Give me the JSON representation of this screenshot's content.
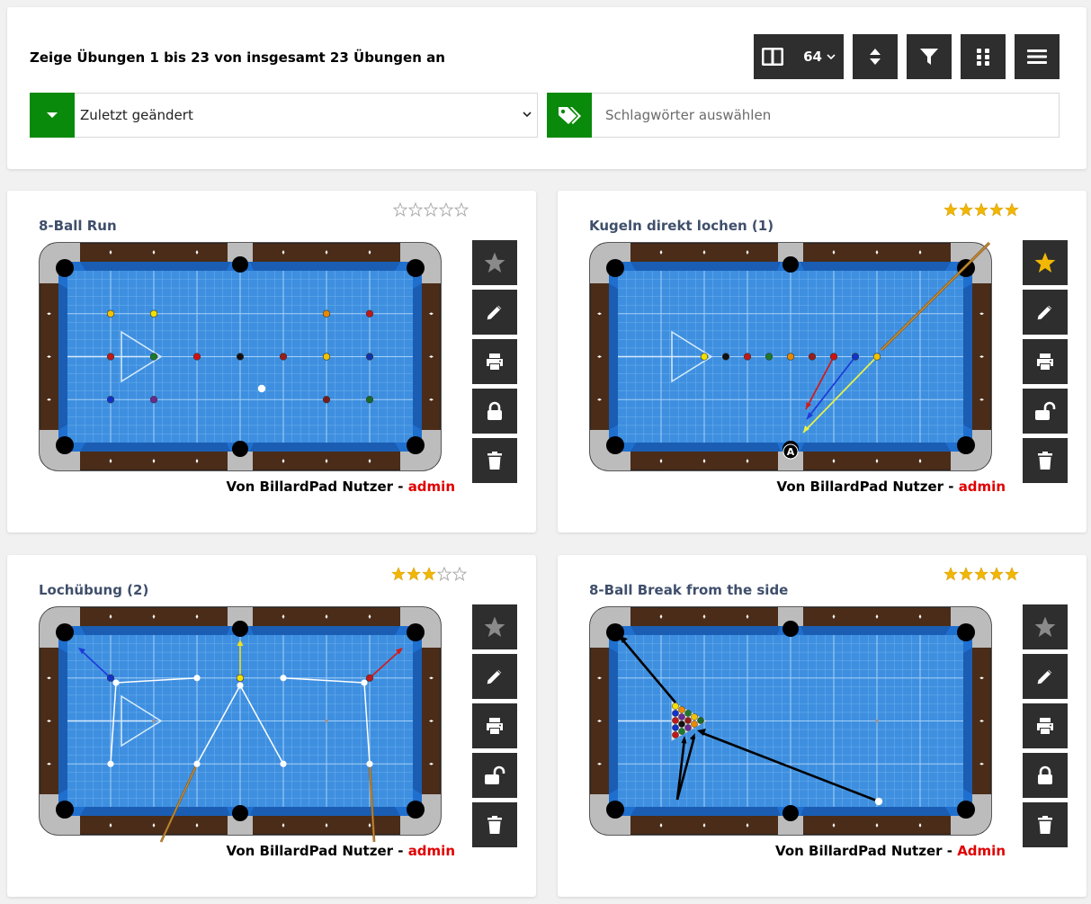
{
  "header": {
    "count_text": "Zeige Übungen 1 bis 23 von insgesamt 23 Übungen an",
    "page_size": "64",
    "sort_select": "Zuletzt geändert",
    "tags_placeholder": "Schlagwörter auswählen"
  },
  "colors": {
    "accent_green": "#0a8a0a",
    "button_dark": "#2e2e2e",
    "title": "#3f4f6b",
    "admin_red": "#e00000",
    "star_gold": "#f2b705"
  },
  "cards": [
    {
      "title": "8-Ball Run",
      "rating": 0,
      "favorite": false,
      "locked": true,
      "author_prefix": "Von BillardPad Nutzer - ",
      "author_name": "admin"
    },
    {
      "title": "Kugeln direkt lochen (1)",
      "rating": 5,
      "favorite": true,
      "locked": false,
      "author_prefix": "Von BillardPad Nutzer - ",
      "author_name": "admin"
    },
    {
      "title": "Lochübung (2)",
      "rating": 3,
      "favorite": false,
      "locked": false,
      "author_prefix": "Von BillardPad Nutzer - ",
      "author_name": "admin"
    },
    {
      "title": "8-Ball Break from the side",
      "rating": 5,
      "favorite": false,
      "locked": true,
      "author_prefix": "Von BillardPad Nutzer - ",
      "author_name": "Admin"
    }
  ],
  "icons": [
    "columns-icon",
    "chevron-down-icon",
    "sort-icon",
    "filter-icon",
    "grid-icon",
    "menu-icon",
    "caret-down-icon",
    "tags-icon",
    "star-icon",
    "pencil-icon",
    "print-icon",
    "lock-icon",
    "unlock-icon",
    "trash-icon"
  ]
}
